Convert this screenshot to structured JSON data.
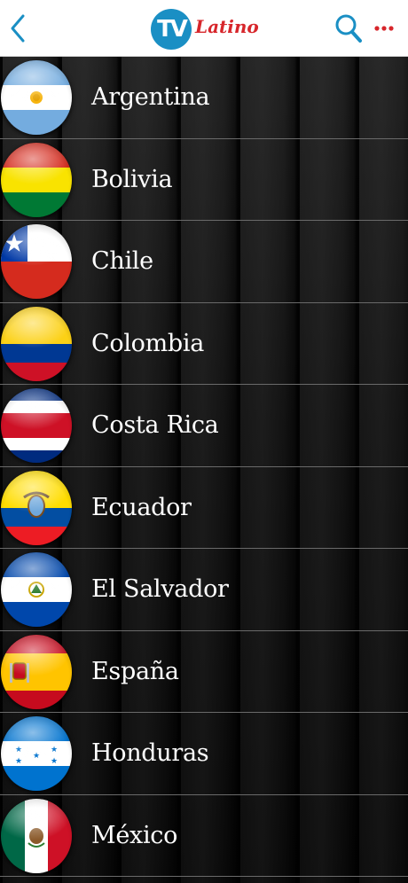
{
  "header": {
    "back_icon": "chevron-left-icon",
    "logo_tv": "TV",
    "logo_word": "Latino",
    "search_icon": "search-icon",
    "more_icon": "more-dots-icon",
    "accent_blue": "#1a8fc4",
    "accent_red": "#d7262b"
  },
  "countries": [
    {
      "name": "Argentina"
    },
    {
      "name": "Bolivia"
    },
    {
      "name": "Chile"
    },
    {
      "name": "Colombia"
    },
    {
      "name": "Costa Rica"
    },
    {
      "name": "Ecuador"
    },
    {
      "name": "El Salvador"
    },
    {
      "name": "España"
    },
    {
      "name": "Honduras"
    },
    {
      "name": "México"
    }
  ]
}
